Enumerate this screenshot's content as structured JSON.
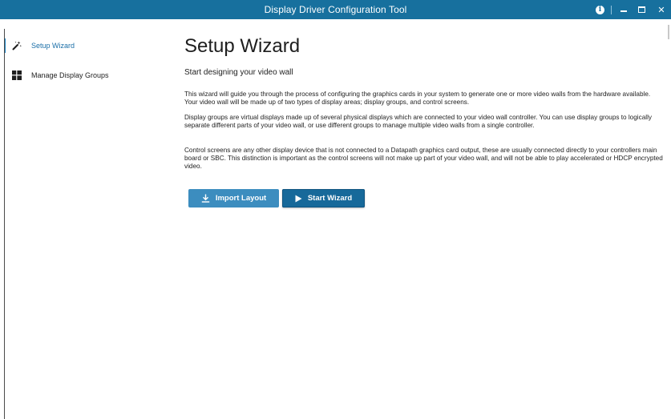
{
  "window": {
    "title": "Display Driver Configuration Tool",
    "accent_color": "#17709e",
    "controls": [
      "info-icon",
      "minimize-icon",
      "maximize-icon",
      "close-icon"
    ]
  },
  "sidebar": {
    "items": [
      {
        "label": "Setup Wizard",
        "icon": "magic-wand-icon",
        "active": true
      },
      {
        "label": "Manage Display Groups",
        "icon": "grid-icon",
        "active": false
      }
    ],
    "active_color": "#1b85c5"
  },
  "main": {
    "title": "Setup Wizard",
    "subtitle": "Start designing your video wall",
    "paragraphs": [
      "This wizard will guide you through the process of configuring the graphics cards in your system to generate one or more video walls from the hardware available. Your video wall will be made up of two types of display areas; display groups, and control screens.",
      "Display groups are virtual displays made up of several physical displays which are connected to your video wall controller. You can use display groups to logically separate different parts of your video wall, or use different groups to manage multiple video walls from a single controller.",
      "Control screens are any other display device that is not connected to a Datapath graphics card output, these are usually connected directly to your controllers main board or SBC. This distinction is important as the control screens will not make up part of your video wall, and will not be able to play accelerated or HDCP encrypted video."
    ],
    "buttons": {
      "import_label": "Import Layout",
      "import_icon": "download-icon",
      "start_label": "Start Wizard",
      "start_icon": "play-icon"
    },
    "button_color": "#3c8dbf",
    "button_active_color": "#17699a"
  }
}
